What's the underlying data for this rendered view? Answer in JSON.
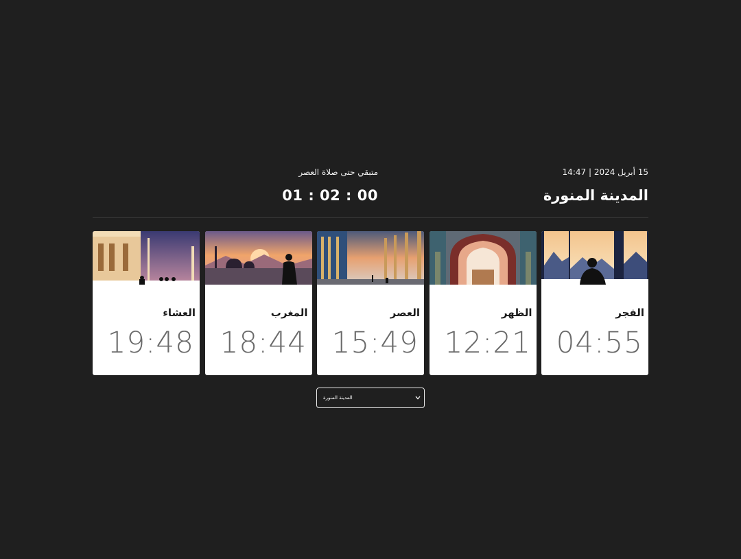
{
  "header": {
    "date_line": "15 أبريل 2024 | 14:47",
    "city_title": "المدينة المنورة",
    "remaining_label": "متبقي حتى صلاة العصر",
    "countdown": "01 : 02 : 00"
  },
  "prayers": [
    {
      "name": "الفجر",
      "time": "04:55",
      "image": "man-silhouette-window-mountains"
    },
    {
      "name": "الظهر",
      "time": "12:21",
      "image": "mosque-arch-tilework"
    },
    {
      "name": "العصر",
      "time": "15:49",
      "image": "mosque-colonnade-sunset"
    },
    {
      "name": "المغرب",
      "time": "18:44",
      "image": "man-silhouette-mosque-sunset-lake"
    },
    {
      "name": "العشاء",
      "time": "19:48",
      "image": "mosque-night-minaret"
    }
  ],
  "city_select": {
    "selected": "المدينة المنورة",
    "icon": "chevron-down-icon"
  },
  "colors": {
    "background": "#1f1f1f",
    "card": "#ffffff",
    "time_text": "#6a6a6a",
    "name_text": "#1a1a1a"
  }
}
